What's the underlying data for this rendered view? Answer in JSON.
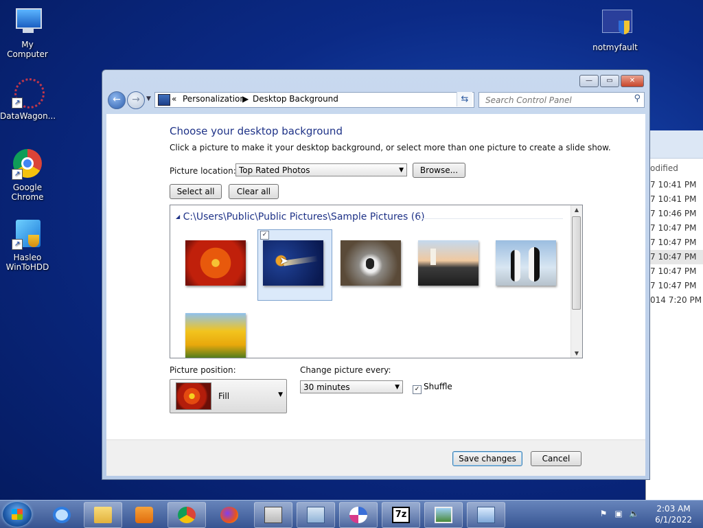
{
  "desktop": {
    "icons": [
      {
        "label": "My Computer"
      },
      {
        "label": "DataWagon..."
      },
      {
        "label": "Google Chrome"
      },
      {
        "label": "Hasleo WinToHDD"
      },
      {
        "label": "notmyfault"
      }
    ]
  },
  "background_window": {
    "column_header": "odified",
    "rows": [
      "7 10:41 PM",
      "7 10:41 PM",
      "7 10:46 PM",
      "7 10:47 PM",
      "7 10:47 PM",
      "7 10:47 PM",
      "7 10:47 PM",
      "7 10:47 PM",
      "014 7:20 PM"
    ]
  },
  "window": {
    "breadcrumb_root_glyph": "«",
    "breadcrumb": [
      "Personalization",
      "Desktop Background"
    ],
    "search_placeholder": "Search Control Panel",
    "title": "Choose your desktop background",
    "description": "Click a picture to make it your desktop background, or select more than one picture to create a slide show.",
    "picture_location_label": "Picture location:",
    "picture_location_value": "Top Rated Photos",
    "browse_label": "Browse...",
    "select_all_label": "Select all",
    "clear_all_label": "Clear all",
    "group_header": "C:\\Users\\Public\\Public Pictures\\Sample Pictures (6)",
    "thumbnails": [
      {
        "name": "chrysanthemum",
        "selected": false
      },
      {
        "name": "jellyfish",
        "selected": true
      },
      {
        "name": "koala",
        "selected": false
      },
      {
        "name": "lighthouse",
        "selected": false
      },
      {
        "name": "penguins",
        "selected": false
      },
      {
        "name": "tulips",
        "selected": false
      }
    ],
    "picture_position_label": "Picture position:",
    "picture_position_value": "Fill",
    "change_every_label": "Change picture every:",
    "change_every_value": "30 minutes",
    "shuffle_label": "Shuffle",
    "shuffle_checked": true,
    "save_label": "Save changes",
    "cancel_label": "Cancel"
  },
  "taskbar": {
    "pinned": [
      "internet-explorer",
      "file-explorer",
      "media-player",
      "chrome",
      "firefox",
      "app-v",
      "calculator",
      "pinwheel-app",
      "7zip",
      "photo-viewer",
      "control-panel"
    ],
    "clock_time": "2:03 AM",
    "clock_date": "6/1/2022"
  },
  "colors": {
    "accent_title": "#1e3287",
    "selection": "#dbe9fa"
  }
}
